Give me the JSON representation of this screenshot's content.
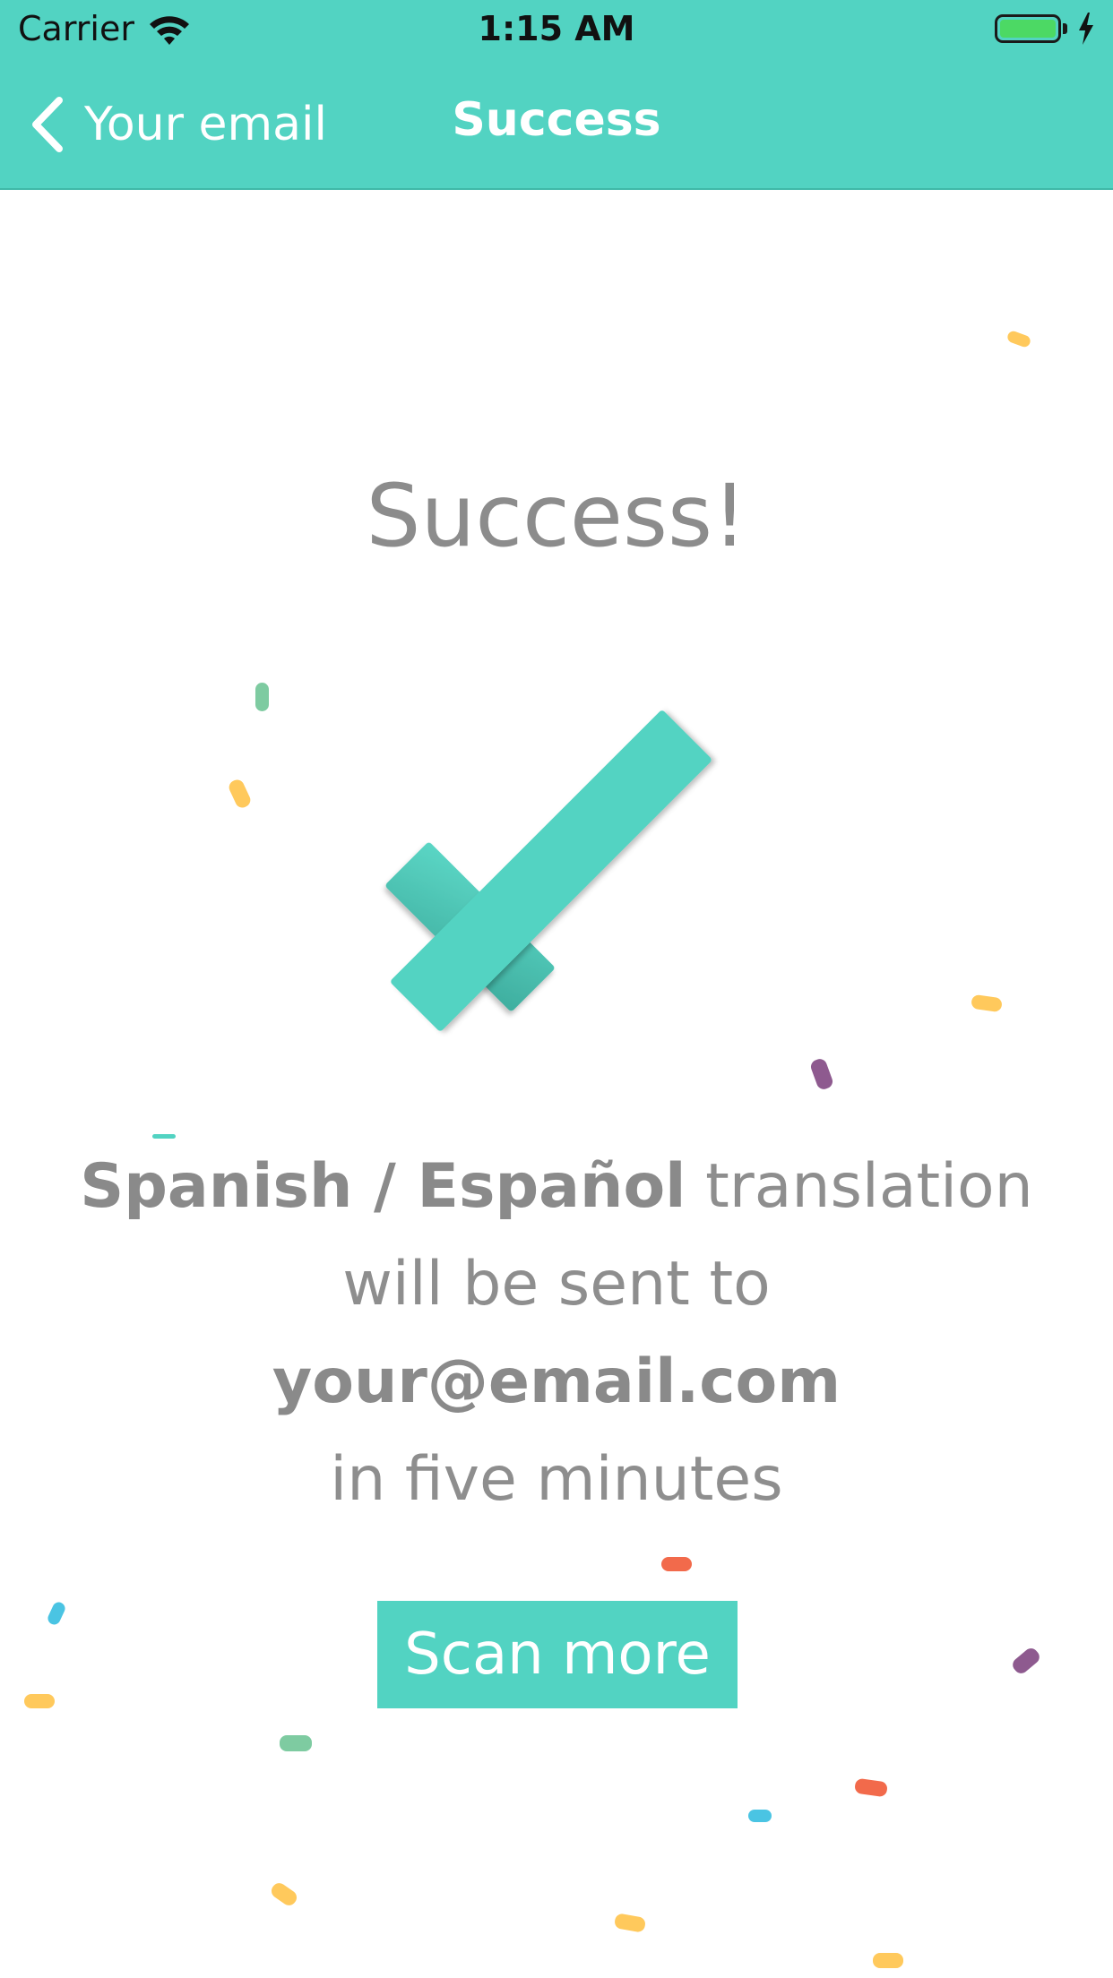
{
  "status_bar": {
    "carrier": "Carrier",
    "time": "1:15 AM"
  },
  "nav": {
    "back_label": "Your email",
    "title": "Success"
  },
  "main": {
    "headline": "Success!",
    "language": "Spanish / Español",
    "text_translation": "translation",
    "text_sent_to": "will be sent to",
    "email": "your@email.com",
    "text_time": "in five minutes"
  },
  "actions": {
    "scan_more_label": "Scan more"
  },
  "colors": {
    "accent": "#52D3C2",
    "battery": "#4CD964",
    "text": "#8e8e8e"
  },
  "icons": [
    "wifi-icon",
    "battery-icon",
    "charging-bolt-icon",
    "back-chevron-icon",
    "checkmark-icon",
    "confetti-piece"
  ]
}
